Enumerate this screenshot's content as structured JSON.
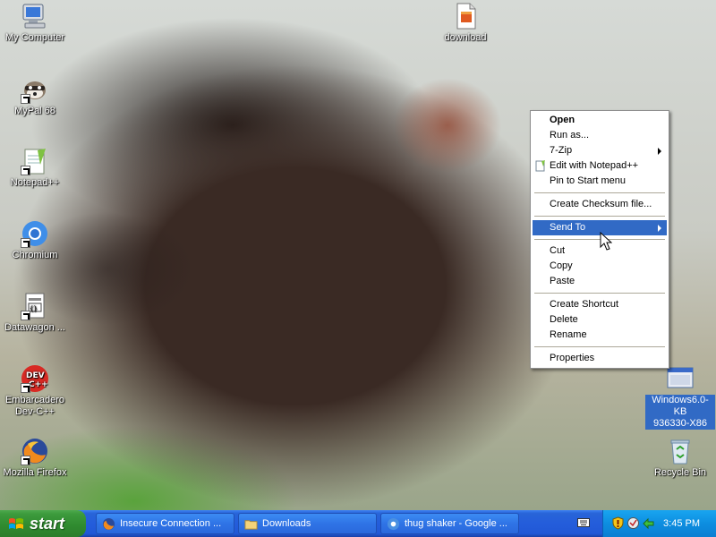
{
  "desktop": {
    "icons_left": [
      {
        "label": "My Computer",
        "icon": "my-computer-icon"
      },
      {
        "label": "MyPal 68",
        "icon": "mypal-icon"
      },
      {
        "label": "Notepad++",
        "icon": "notepad-plus-plus-icon"
      },
      {
        "label": "Chromium",
        "icon": "chromium-icon"
      },
      {
        "label": "Datawagon ...",
        "icon": "datawagon-icon"
      },
      {
        "label": "Embarcadero\nDev-C++",
        "icon": "dev-cpp-icon"
      },
      {
        "label": "Mozilla Firefox",
        "icon": "firefox-icon"
      }
    ],
    "icons_right": [
      {
        "label": "download",
        "icon": "download-file-icon"
      },
      {
        "label": "Windows6.0-KB\n936330-X86",
        "icon": "windows-update-icon"
      },
      {
        "label": "Recycle Bin",
        "icon": "recycle-bin-icon"
      }
    ]
  },
  "context_menu": {
    "items": [
      {
        "label": "Open",
        "bold": true
      },
      {
        "label": "Run as..."
      },
      {
        "label": "7-Zip",
        "submenu": true
      },
      {
        "label": "Edit with Notepad++",
        "icon": "notepad-plus-plus-icon"
      },
      {
        "label": "Pin to Start menu"
      },
      {
        "label": "Create Checksum file..."
      },
      {
        "label": "Send To",
        "submenu": true,
        "highlighted": true
      },
      {
        "label": "Cut"
      },
      {
        "label": "Copy"
      },
      {
        "label": "Paste"
      },
      {
        "label": "Create Shortcut"
      },
      {
        "label": "Delete"
      },
      {
        "label": "Rename"
      },
      {
        "label": "Properties"
      }
    ]
  },
  "taskbar": {
    "start_label": "start",
    "buttons": [
      {
        "label": "Insecure Connection ...",
        "icon": "firefox-icon"
      },
      {
        "label": "Downloads",
        "icon": "folder-icon"
      },
      {
        "label": "thug shaker - Google ...",
        "icon": "chromium-icon"
      }
    ],
    "clock": "3:45 PM"
  },
  "colors": {
    "taskbar_blue": "#245ddb",
    "start_green": "#3c9a3c",
    "menu_highlight": "#316ac5",
    "tray_blue": "#0d8ee0"
  }
}
